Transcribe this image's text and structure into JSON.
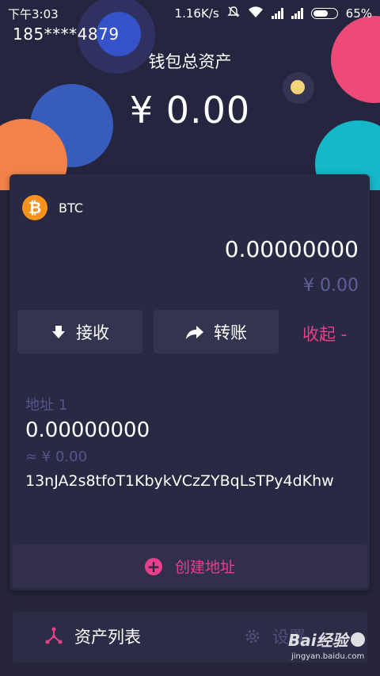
{
  "status_bar": {
    "time": "下午3:03",
    "network_speed": "1.16K/s",
    "battery_percent": "65%",
    "icons": [
      "mute-icon",
      "wifi-icon",
      "signal-icon",
      "signal-icon",
      "battery-icon"
    ]
  },
  "header": {
    "account": "185****4879",
    "title": "钱包总资产",
    "total_amount": "¥ 0.00"
  },
  "coin": {
    "symbol_glyph": "₿",
    "name": "BTC",
    "balance": "0.00000000",
    "fiat_value": "¥ 0.00"
  },
  "actions": {
    "receive": "接收",
    "transfer": "转账",
    "collapse": "收起 -"
  },
  "address": {
    "label": "地址 1",
    "balance": "0.00000000",
    "fiat_value": "≈ ¥ 0.00",
    "value": "13nJA2s8tfoT1KbykVCzZYBqLsTPy4dKhw"
  },
  "create_address": {
    "label": "创建地址"
  },
  "bottom_nav": {
    "assets": "资产列表",
    "settings": "设置"
  },
  "watermark": {
    "text": "Bai经验",
    "sub": "jingyan.baidu.com"
  },
  "colors": {
    "accent": "#e83e8c",
    "background": "#25243a",
    "card": "#2a2944",
    "muted": "#52558d",
    "btc": "#f7931a"
  }
}
